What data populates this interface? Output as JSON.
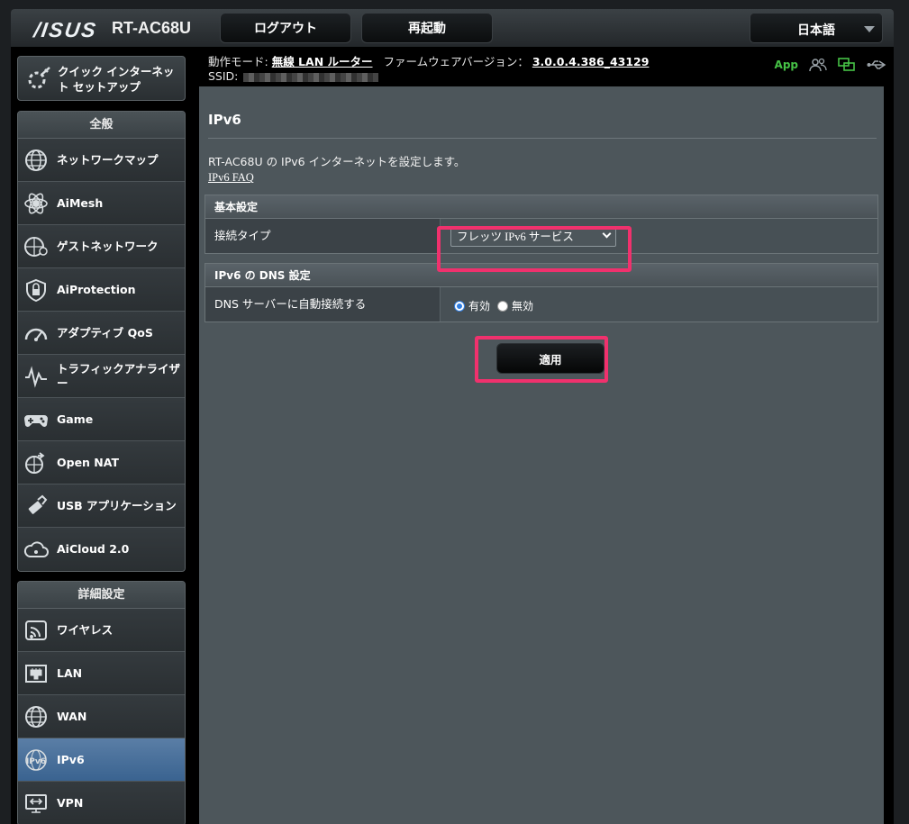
{
  "header": {
    "logo": "/ISUS",
    "model": "RT-AC68U",
    "logout": "ログアウト",
    "reboot": "再起動",
    "language": "日本語"
  },
  "info": {
    "mode_label": "動作モード:",
    "mode_value": "無線 LAN ルーター",
    "fw_label": "ファームウェアバージョン：",
    "fw_value": "3.0.0.4.386_43129",
    "ssid_label": "SSID:",
    "app": "App"
  },
  "sidebar": {
    "quick_setup": "クイック インターネット セットアップ",
    "general_title": "全般",
    "general": [
      {
        "label": "ネットワークマップ",
        "icon": "globe-icon"
      },
      {
        "label": "AiMesh",
        "icon": "mesh-icon"
      },
      {
        "label": "ゲストネットワーク",
        "icon": "guest-network-icon"
      },
      {
        "label": "AiProtection",
        "icon": "lock-shield-icon"
      },
      {
        "label": "アダプティブ QoS",
        "icon": "speedometer-icon"
      },
      {
        "label": "トラフィックアナライザー",
        "icon": "traffic-wave-icon"
      },
      {
        "label": "Game",
        "icon": "gamepad-icon"
      },
      {
        "label": "Open NAT",
        "icon": "open-nat-icon"
      },
      {
        "label": "USB アプリケーション",
        "icon": "usb-icon"
      },
      {
        "label": "AiCloud 2.0",
        "icon": "cloud-icon"
      }
    ],
    "advanced_title": "詳細設定",
    "advanced": [
      {
        "label": "ワイヤレス",
        "icon": "wireless-icon"
      },
      {
        "label": "LAN",
        "icon": "lan-icon"
      },
      {
        "label": "WAN",
        "icon": "wan-globe-icon"
      },
      {
        "label": "IPv6",
        "icon": "ipv6-globe-icon"
      },
      {
        "label": "VPN",
        "icon": "vpn-icon"
      }
    ]
  },
  "main": {
    "title": "IPv6",
    "description": "RT-AC68U の IPv6 インターネットを設定します。",
    "faq_link": "IPv6 FAQ",
    "basic_header": "基本設定",
    "connection_type_label": "接続タイプ",
    "connection_type_value": "フレッツ IPv6 サービス",
    "dns_header": "IPv6 の DNS 設定",
    "dns_auto_label": "DNS サーバーに自動接続する",
    "radio_enable": "有効",
    "radio_disable": "無効",
    "apply": "適用"
  },
  "colors": {
    "highlight": "#f0316d",
    "active_item": "#3a6390",
    "app_green": "#46c246"
  }
}
